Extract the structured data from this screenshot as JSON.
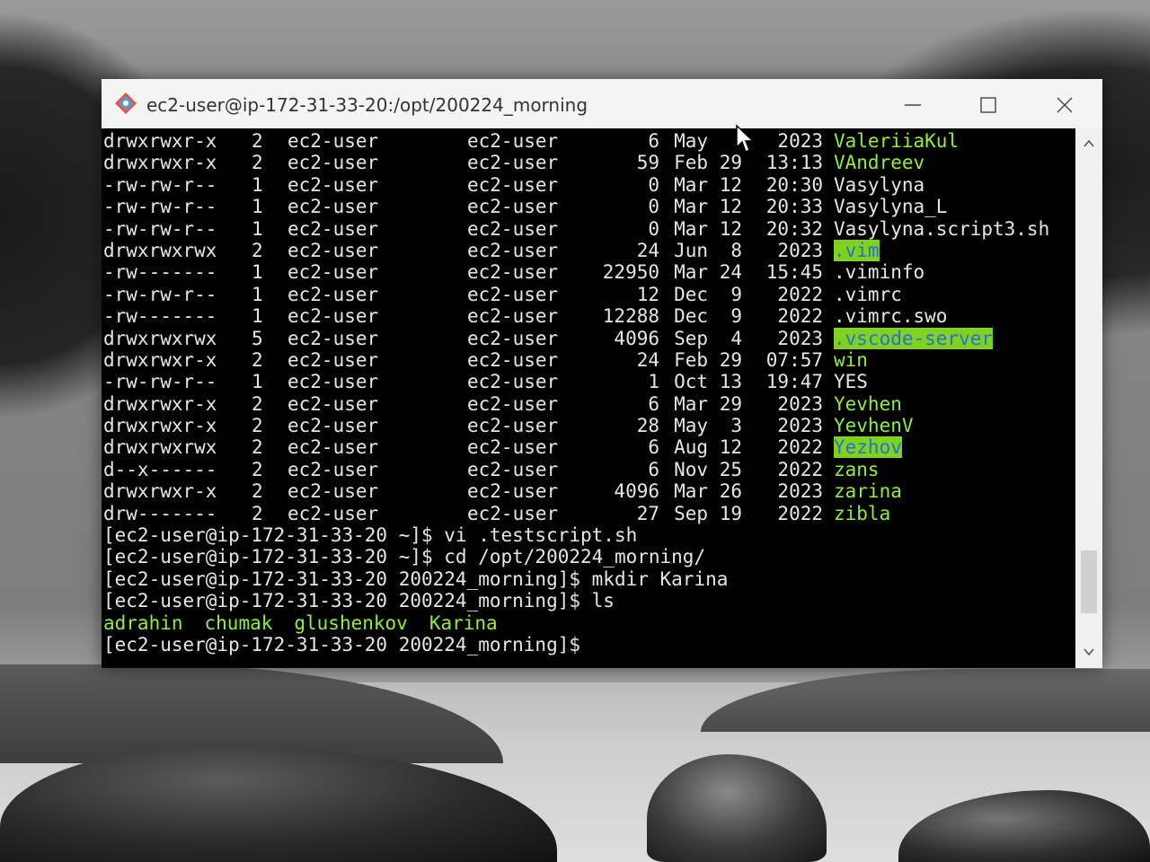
{
  "window": {
    "title": "ec2-user@ip-172-31-33-20:/opt/200224_morning",
    "controls": {
      "minimize": "—",
      "maximize": "☐",
      "close": "✕"
    }
  },
  "listing": [
    {
      "perm": "drwxrwxr-x",
      "links": "2",
      "owner": "ec2-user",
      "group": "ec2-user",
      "size": "6",
      "month": "May",
      "day": "",
      "time": "2023",
      "name": "ValeriiaKul",
      "kind": "dir"
    },
    {
      "perm": "drwxrwxr-x",
      "links": "2",
      "owner": "ec2-user",
      "group": "ec2-user",
      "size": "59",
      "month": "Feb",
      "day": "29",
      "time": "13:13",
      "name": "VAndreev",
      "kind": "dir"
    },
    {
      "perm": "-rw-rw-r--",
      "links": "1",
      "owner": "ec2-user",
      "group": "ec2-user",
      "size": "0",
      "month": "Mar",
      "day": "12",
      "time": "20:30",
      "name": "Vasylyna",
      "kind": "file"
    },
    {
      "perm": "-rw-rw-r--",
      "links": "1",
      "owner": "ec2-user",
      "group": "ec2-user",
      "size": "0",
      "month": "Mar",
      "day": "12",
      "time": "20:33",
      "name": "Vasylyna_L",
      "kind": "file"
    },
    {
      "perm": "-rw-rw-r--",
      "links": "1",
      "owner": "ec2-user",
      "group": "ec2-user",
      "size": "0",
      "month": "Mar",
      "day": "12",
      "time": "20:32",
      "name": "Vasylyna.script3.sh",
      "kind": "file"
    },
    {
      "perm": "drwxrwxrwx",
      "links": "2",
      "owner": "ec2-user",
      "group": "ec2-user",
      "size": "24",
      "month": "Jun",
      "day": "8",
      "time": "2023",
      "name": ".vim",
      "kind": "sticky"
    },
    {
      "perm": "-rw-------",
      "links": "1",
      "owner": "ec2-user",
      "group": "ec2-user",
      "size": "22950",
      "month": "Mar",
      "day": "24",
      "time": "15:45",
      "name": ".viminfo",
      "kind": "file"
    },
    {
      "perm": "-rw-rw-r--",
      "links": "1",
      "owner": "ec2-user",
      "group": "ec2-user",
      "size": "12",
      "month": "Dec",
      "day": "9",
      "time": "2022",
      "name": ".vimrc",
      "kind": "file"
    },
    {
      "perm": "-rw-------",
      "links": "1",
      "owner": "ec2-user",
      "group": "ec2-user",
      "size": "12288",
      "month": "Dec",
      "day": "9",
      "time": "2022",
      "name": ".vimrc.swo",
      "kind": "file"
    },
    {
      "perm": "drwxrwxrwx",
      "links": "5",
      "owner": "ec2-user",
      "group": "ec2-user",
      "size": "4096",
      "month": "Sep",
      "day": "4",
      "time": "2023",
      "name": ".vscode-server",
      "kind": "sticky"
    },
    {
      "perm": "drwxrwxr-x",
      "links": "2",
      "owner": "ec2-user",
      "group": "ec2-user",
      "size": "24",
      "month": "Feb",
      "day": "29",
      "time": "07:57",
      "name": "win",
      "kind": "dir"
    },
    {
      "perm": "-rw-rw-r--",
      "links": "1",
      "owner": "ec2-user",
      "group": "ec2-user",
      "size": "1",
      "month": "Oct",
      "day": "13",
      "time": "19:47",
      "name": "YES",
      "kind": "file"
    },
    {
      "perm": "drwxrwxr-x",
      "links": "2",
      "owner": "ec2-user",
      "group": "ec2-user",
      "size": "6",
      "month": "Mar",
      "day": "29",
      "time": "2023",
      "name": "Yevhen",
      "kind": "dir"
    },
    {
      "perm": "drwxrwxr-x",
      "links": "2",
      "owner": "ec2-user",
      "group": "ec2-user",
      "size": "28",
      "month": "May",
      "day": "3",
      "time": "2023",
      "name": "YevhenV",
      "kind": "dir"
    },
    {
      "perm": "drwxrwxrwx",
      "links": "2",
      "owner": "ec2-user",
      "group": "ec2-user",
      "size": "6",
      "month": "Aug",
      "day": "12",
      "time": "2022",
      "name": "Yezhov",
      "kind": "sticky"
    },
    {
      "perm": "d--x------",
      "links": "2",
      "owner": "ec2-user",
      "group": "ec2-user",
      "size": "6",
      "month": "Nov",
      "day": "25",
      "time": "2022",
      "name": "zans",
      "kind": "dir"
    },
    {
      "perm": "drwxrwxr-x",
      "links": "2",
      "owner": "ec2-user",
      "group": "ec2-user",
      "size": "4096",
      "month": "Mar",
      "day": "26",
      "time": "2023",
      "name": "zarina",
      "kind": "dir"
    },
    {
      "perm": "drw-------",
      "links": "2",
      "owner": "ec2-user",
      "group": "ec2-user",
      "size": "27",
      "month": "Sep",
      "day": "19",
      "time": "2022",
      "name": "zibla",
      "kind": "dir"
    }
  ],
  "commands": [
    "[ec2-user@ip-172-31-33-20 ~]$ vi .testscript.sh",
    "[ec2-user@ip-172-31-33-20 ~]$ cd /opt/200224_morning/",
    "[ec2-user@ip-172-31-33-20 200224_morning]$ mkdir Karina",
    "[ec2-user@ip-172-31-33-20 200224_morning]$ ls"
  ],
  "ls_output": [
    "adrahin",
    "chumak",
    "glushenkov",
    "Karina"
  ],
  "prompt": "[ec2-user@ip-172-31-33-20 200224_morning]$ ",
  "colors": {
    "directory": "#8fef3a",
    "terminal_text": "#e6e6e6",
    "terminal_background": "#000000",
    "sticky_bg": "#7fd21e",
    "sticky_fg": "#2a6fd4"
  }
}
